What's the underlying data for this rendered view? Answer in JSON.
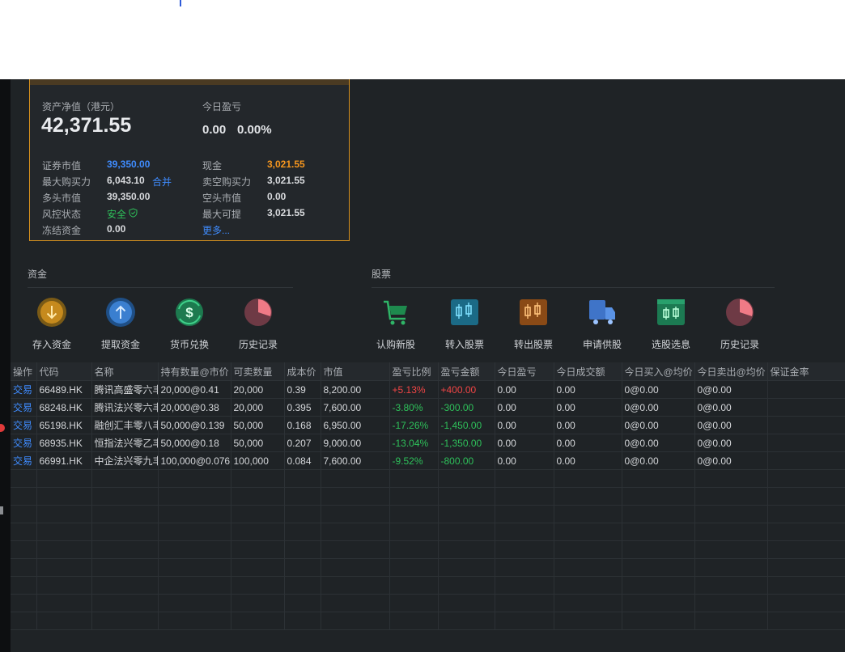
{
  "asset": {
    "nav_label": "资产净值（港元）",
    "nav_value": "42,371.55",
    "today_pl_label": "今日盈亏",
    "today_pl_value": "0.00",
    "today_pl_pct": "0.00%",
    "rows_left": [
      {
        "label": "证券市值",
        "value": "39,350.00"
      },
      {
        "label": "最大购买力",
        "value": "6,043.10",
        "link": "合并"
      },
      {
        "label": "多头市值",
        "value": "39,350.00"
      },
      {
        "label": "风控状态",
        "value": "安全"
      },
      {
        "label": "冻结资金",
        "value": "0.00"
      }
    ],
    "rows_right": [
      {
        "label": "现金",
        "value": "3,021.55"
      },
      {
        "label": "卖空购买力",
        "value": "3,021.55"
      },
      {
        "label": "空头市值",
        "value": "0.00"
      },
      {
        "label": "最大可提",
        "value": "3,021.55"
      }
    ],
    "more_link": "更多..."
  },
  "funds": {
    "title": "资金",
    "actions": [
      {
        "label": "存入资金",
        "icon": "deposit-icon"
      },
      {
        "label": "提取资金",
        "icon": "withdraw-icon"
      },
      {
        "label": "货币兑换",
        "icon": "currency-exchange-icon"
      },
      {
        "label": "历史记录",
        "icon": "history-icon"
      }
    ]
  },
  "stocks": {
    "title": "股票",
    "actions": [
      {
        "label": "认购新股",
        "icon": "cart-icon"
      },
      {
        "label": "转入股票",
        "icon": "transfer-in-icon"
      },
      {
        "label": "转出股票",
        "icon": "transfer-out-icon"
      },
      {
        "label": "申请供股",
        "icon": "truck-icon"
      },
      {
        "label": "选股选息",
        "icon": "stock-select-icon"
      },
      {
        "label": "历史记录",
        "icon": "history-icon"
      }
    ]
  },
  "table": {
    "headers": [
      "操作",
      "代码",
      "名称",
      "持有数量@市价",
      "可卖数量",
      "成本价",
      "市值",
      "盈亏比例",
      "盈亏金额",
      "今日盈亏",
      "今日成交额",
      "今日买入@均价",
      "今日卖出@均价",
      "保证金率"
    ],
    "rows": [
      [
        "交易",
        "66489.HK",
        "腾讯高盛零六丰",
        "20,000@0.41",
        "20,000",
        "0.39",
        "8,200.00",
        "+5.13%",
        "+400.00",
        "0.00",
        "0.00",
        "0@0.00",
        "0@0.00",
        ""
      ],
      [
        "交易",
        "68248.HK",
        "腾讯法兴零六丰",
        "20,000@0.38",
        "20,000",
        "0.395",
        "7,600.00",
        "-3.80%",
        "-300.00",
        "0.00",
        "0.00",
        "0@0.00",
        "0@0.00",
        ""
      ],
      [
        "交易",
        "65198.HK",
        "融创汇丰零八丰",
        "50,000@0.139",
        "50,000",
        "0.168",
        "6,950.00",
        "-17.26%",
        "-1,450.00",
        "0.00",
        "0.00",
        "0@0.00",
        "0@0.00",
        ""
      ],
      [
        "交易",
        "68935.HK",
        "恒指法兴零乙丰",
        "50,000@0.18",
        "50,000",
        "0.207",
        "9,000.00",
        "-13.04%",
        "-1,350.00",
        "0.00",
        "0.00",
        "0@0.00",
        "0@0.00",
        ""
      ],
      [
        "交易",
        "66991.HK",
        "中企法兴零九丰",
        "100,000@0.076",
        "100,000",
        "0.084",
        "7,600.00",
        "-9.52%",
        "-800.00",
        "0.00",
        "0.00",
        "0@0.00",
        "0@0.00",
        ""
      ]
    ],
    "pl_colors": [
      "red",
      "green",
      "green",
      "green",
      "green"
    ]
  },
  "colors": {
    "accent": "#3f8cff",
    "up": "#f04545",
    "down": "#2ec05a",
    "highlight": "#f6961e",
    "card_border": "#d5901e"
  }
}
